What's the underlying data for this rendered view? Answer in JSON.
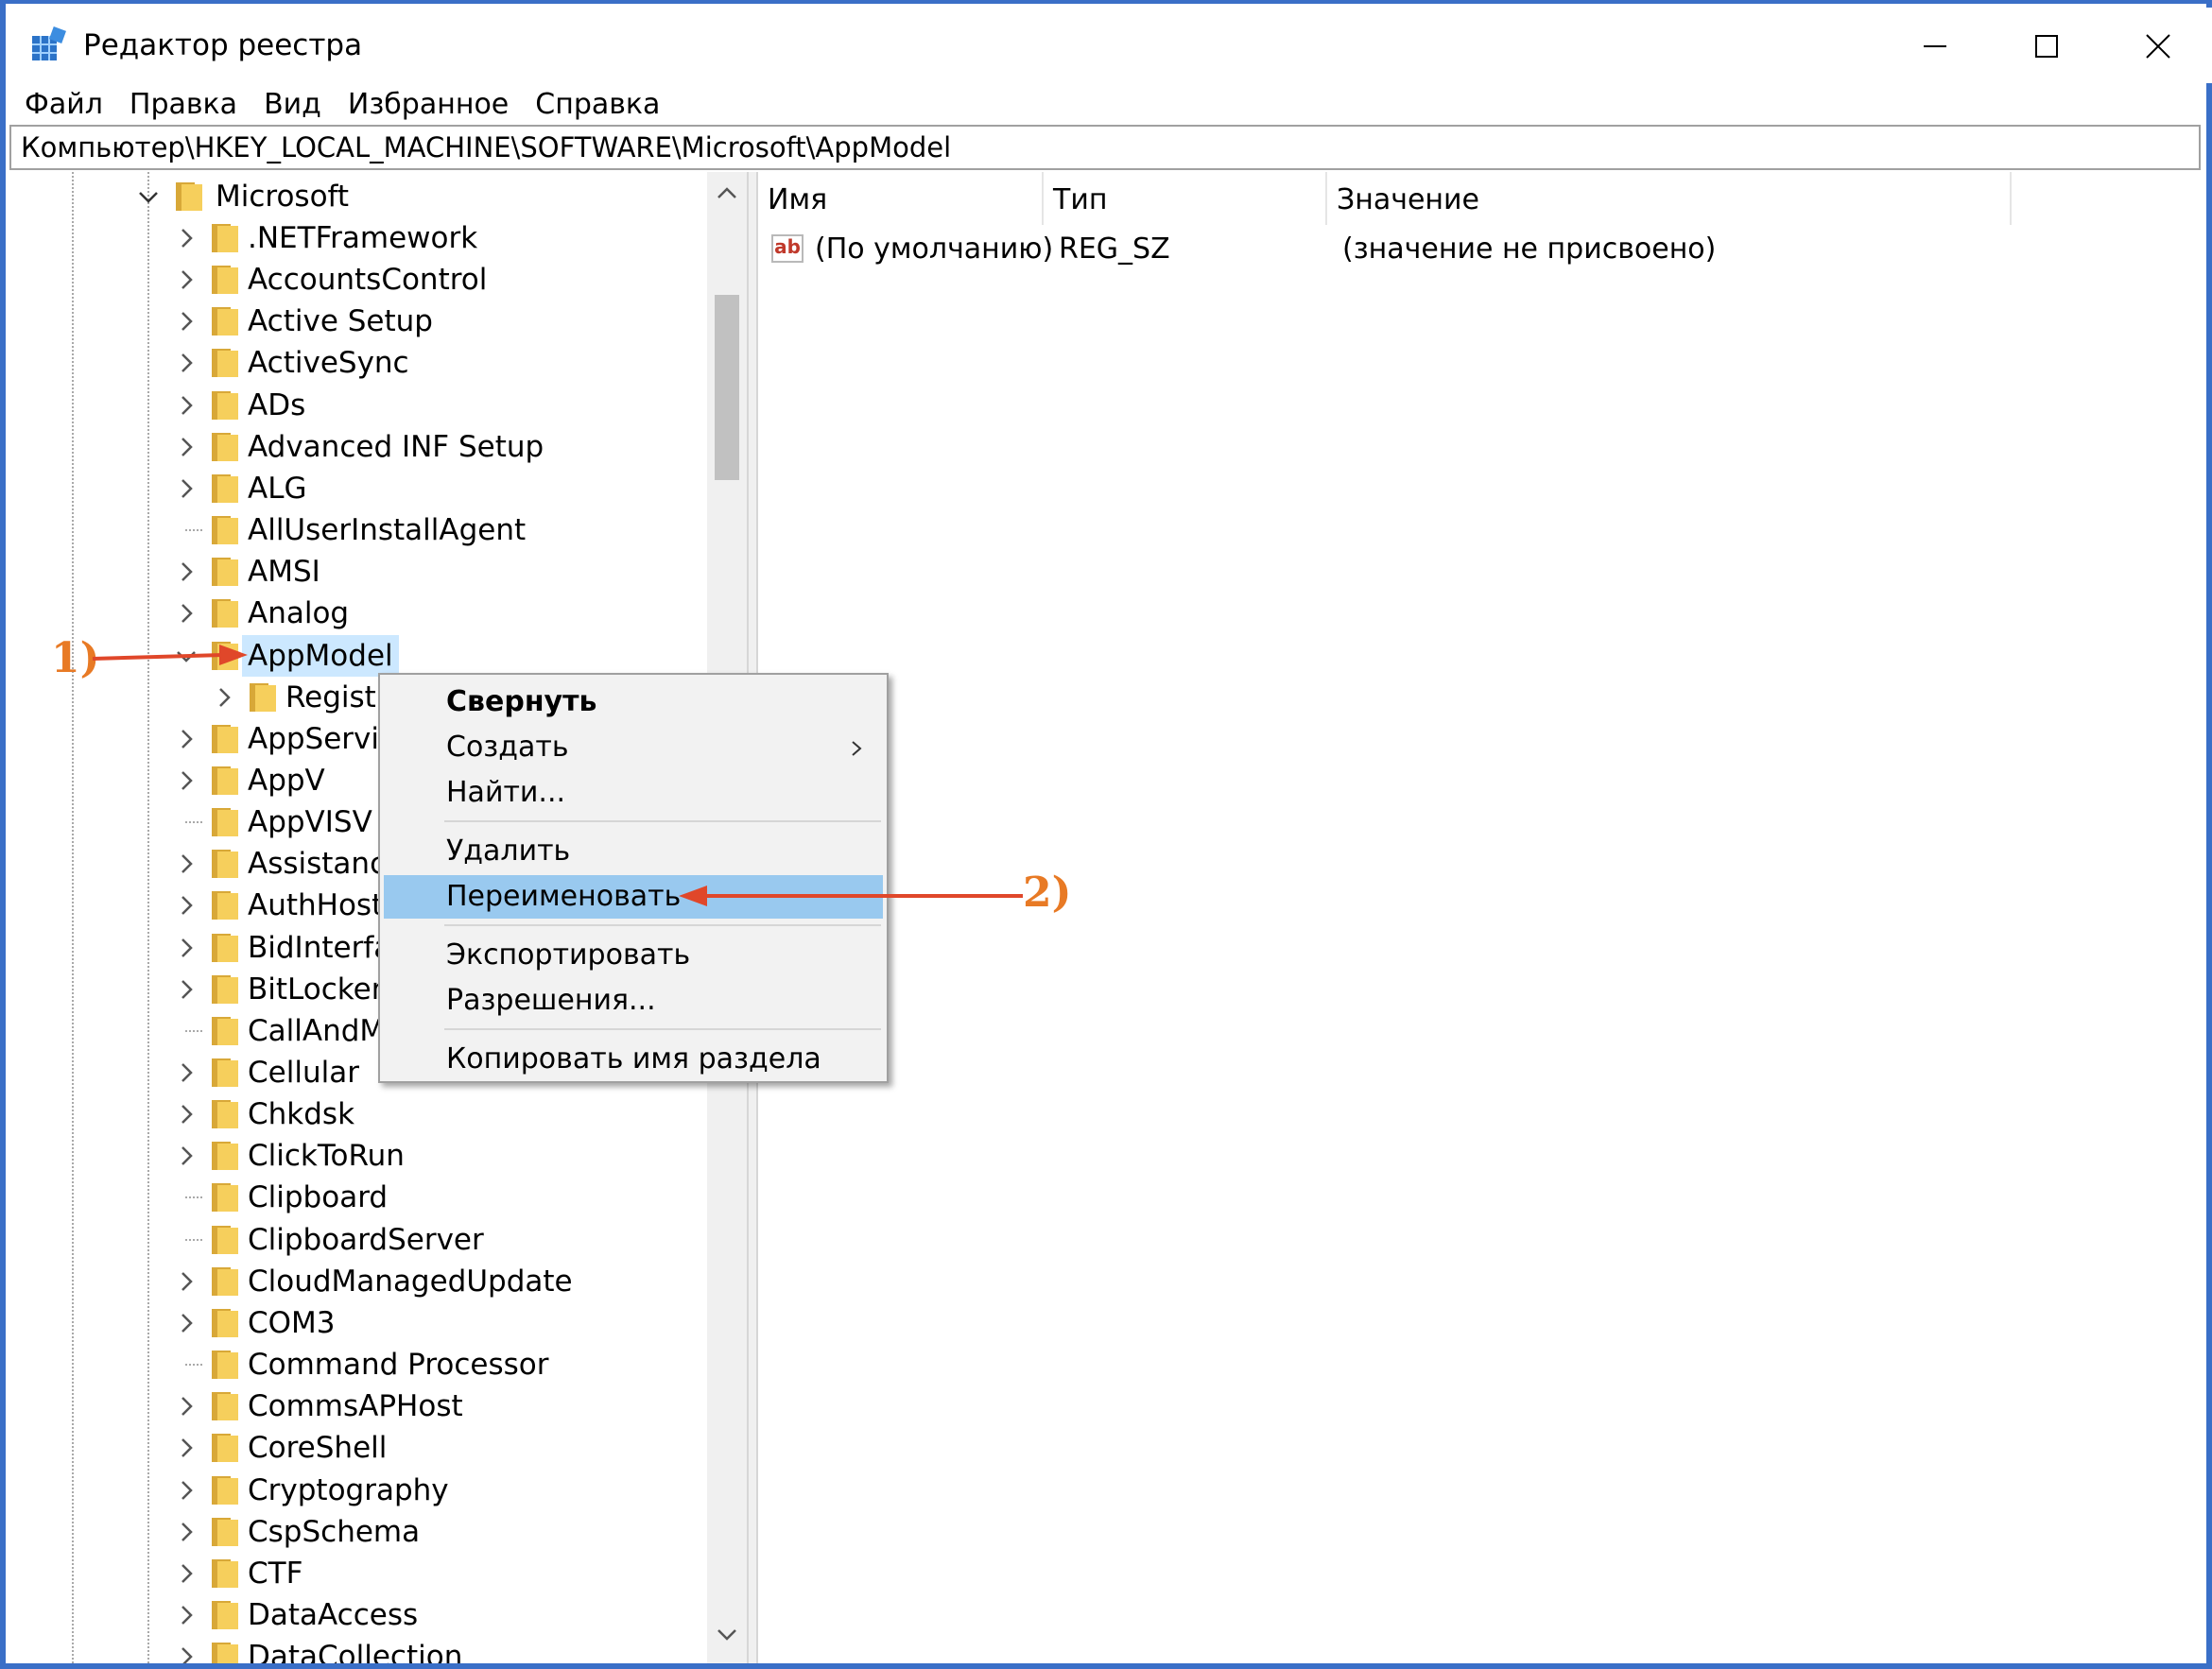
{
  "window": {
    "title": "Редактор реестра",
    "icons": {
      "app": "registry-editor-icon",
      "minimize": "minimize-icon",
      "maximize": "maximize-icon",
      "close": "close-icon"
    }
  },
  "menubar": [
    "Файл",
    "Правка",
    "Вид",
    "Избранное",
    "Справка"
  ],
  "address_path": "Компьютер\\HKEY_LOCAL_MACHINE\\SOFTWARE\\Microsoft\\AppModel",
  "tree": {
    "parent": "Microsoft",
    "items": [
      {
        "label": ".NETFramework",
        "expandable": true
      },
      {
        "label": "AccountsControl",
        "expandable": true
      },
      {
        "label": "Active Setup",
        "expandable": true
      },
      {
        "label": "ActiveSync",
        "expandable": true
      },
      {
        "label": "ADs",
        "expandable": true
      },
      {
        "label": "Advanced INF Setup",
        "expandable": true
      },
      {
        "label": "ALG",
        "expandable": true
      },
      {
        "label": "AllUserInstallAgent",
        "expandable": false
      },
      {
        "label": "AMSI",
        "expandable": true
      },
      {
        "label": "Analog",
        "expandable": true
      },
      {
        "label": "AppModel",
        "expandable": true,
        "expanded": true,
        "selected": true
      },
      {
        "label": "Registr",
        "expandable": true,
        "child": true
      },
      {
        "label": "AppServic",
        "expandable": true
      },
      {
        "label": "AppV",
        "expandable": true
      },
      {
        "label": "AppVISV",
        "expandable": false
      },
      {
        "label": "Assistance",
        "expandable": true
      },
      {
        "label": "AuthHost",
        "expandable": true
      },
      {
        "label": "BidInterfa",
        "expandable": true
      },
      {
        "label": "BitLocker",
        "expandable": true
      },
      {
        "label": "CallAndM",
        "expandable": false
      },
      {
        "label": "Cellular",
        "expandable": true
      },
      {
        "label": "Chkdsk",
        "expandable": true
      },
      {
        "label": "ClickToRun",
        "expandable": true
      },
      {
        "label": "Clipboard",
        "expandable": false
      },
      {
        "label": "ClipboardServer",
        "expandable": false
      },
      {
        "label": "CloudManagedUpdate",
        "expandable": true
      },
      {
        "label": "COM3",
        "expandable": true
      },
      {
        "label": "Command Processor",
        "expandable": false
      },
      {
        "label": "CommsAPHost",
        "expandable": true
      },
      {
        "label": "CoreShell",
        "expandable": true
      },
      {
        "label": "Cryptography",
        "expandable": true
      },
      {
        "label": "CspSchema",
        "expandable": true
      },
      {
        "label": "CTF",
        "expandable": true
      },
      {
        "label": "DataAccess",
        "expandable": true
      },
      {
        "label": "DataCollection",
        "expandable": true
      }
    ]
  },
  "list": {
    "columns": [
      "Имя",
      "Тип",
      "Значение"
    ],
    "rows": [
      {
        "name": "(По умолчанию)",
        "type": "REG_SZ",
        "value": "(значение не присвоено)",
        "icon": "string-value-icon",
        "icon_text": "ab"
      }
    ]
  },
  "context_menu": {
    "items": [
      {
        "label": "Свернуть",
        "bold": true
      },
      {
        "label": "Создать",
        "submenu": true
      },
      {
        "label": "Найти..."
      },
      {
        "separator": true
      },
      {
        "label": "Удалить"
      },
      {
        "label": "Переименовать",
        "highlighted": true
      },
      {
        "separator": true
      },
      {
        "label": "Экспортировать"
      },
      {
        "label": "Разрешения..."
      },
      {
        "separator": true
      },
      {
        "label": "Копировать имя раздела"
      }
    ]
  },
  "annotations": {
    "first": "1)",
    "second": "2)"
  },
  "colors": {
    "accent": "#3a6fc7",
    "selection": "#cce8ff",
    "menu_highlight": "#99c9ef",
    "annotation": "#e87a25"
  }
}
